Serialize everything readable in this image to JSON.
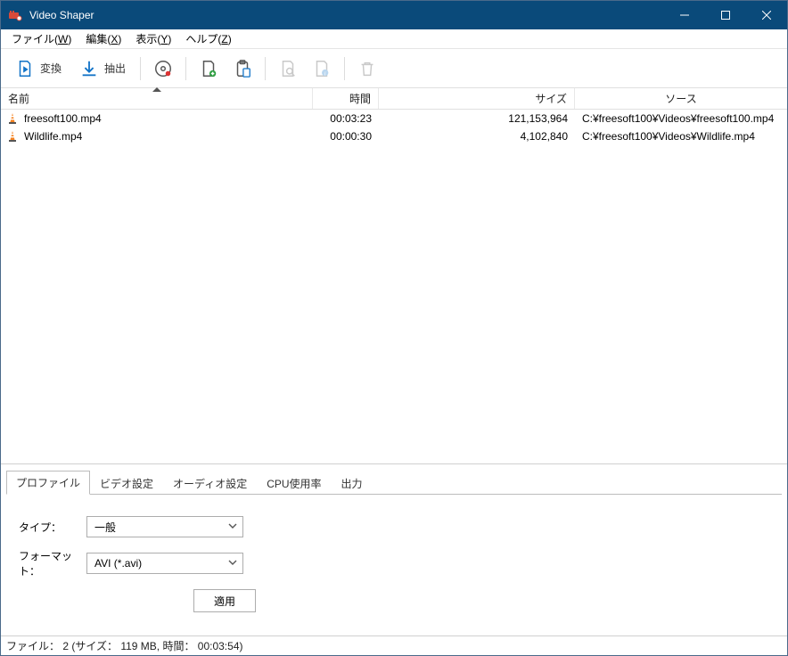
{
  "titlebar": {
    "title": "Video Shaper"
  },
  "menu": {
    "file": {
      "label": "ファイル",
      "mnemonic": "W"
    },
    "edit": {
      "label": "編集",
      "mnemonic": "X"
    },
    "view": {
      "label": "表示",
      "mnemonic": "Y"
    },
    "help": {
      "label": "ヘルプ",
      "mnemonic": "Z"
    }
  },
  "toolbar": {
    "convert_label": "変換",
    "extract_label": "抽出"
  },
  "columns": {
    "name": "名前",
    "time": "時間",
    "size": "サイズ",
    "source": "ソース"
  },
  "files": [
    {
      "name": "freesoft100.mp4",
      "time": "00:03:23",
      "size": "121,153,964",
      "source": "C:¥freesoft100¥Videos¥freesoft100.mp4"
    },
    {
      "name": "Wildlife.mp4",
      "time": "00:00:30",
      "size": "4,102,840",
      "source": "C:¥freesoft100¥Videos¥Wildlife.mp4"
    }
  ],
  "tabs": {
    "profile": "プロファイル",
    "video": "ビデオ設定",
    "audio": "オーディオ設定",
    "cpu": "CPU使用率",
    "output": "出力"
  },
  "profile": {
    "type_label": "タイプ：",
    "type_value": "一般",
    "format_label": "フォーマット：",
    "format_value": "AVI (*.avi)",
    "apply_label": "適用"
  },
  "status": {
    "text": "ファイル： 2 (サイズ： 119 MB, 時間： 00:03:54)"
  }
}
